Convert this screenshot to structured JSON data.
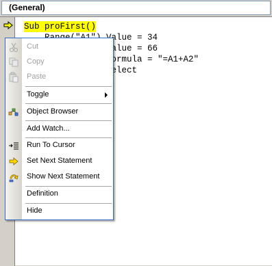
{
  "object_dropdown": {
    "value": "(General)"
  },
  "code": {
    "lines": [
      "Sub proFirst()",
      "    Range(\"A1\").Value = 34",
      "    Range(\"A2\").Value = 66",
      "    Range(\"A3\").Formula = \"=A1+A2\"",
      "    Range(\"A1\").Select"
    ]
  },
  "context_menu": {
    "items": [
      {
        "label": "Cut",
        "icon": "cut-icon",
        "enabled": false
      },
      {
        "label": "Copy",
        "icon": "copy-icon",
        "enabled": false
      },
      {
        "label": "Paste",
        "icon": "paste-icon",
        "enabled": false
      },
      {
        "label": "Toggle",
        "icon": "",
        "enabled": true,
        "submenu": true
      },
      {
        "label": "Object Browser",
        "icon": "object-browser-icon",
        "enabled": true
      },
      {
        "label": "Add Watch...",
        "icon": "",
        "enabled": true
      },
      {
        "label": "Run To Cursor",
        "icon": "run-to-cursor-icon",
        "enabled": true
      },
      {
        "label": "Set Next Statement",
        "icon": "set-next-statement-icon",
        "enabled": true
      },
      {
        "label": "Show Next Statement",
        "icon": "show-next-statement-icon",
        "enabled": true
      },
      {
        "label": "Definition",
        "icon": "",
        "enabled": true
      },
      {
        "label": "Hide",
        "icon": "",
        "enabled": true
      }
    ]
  },
  "colors": {
    "current_line_highlight": "#ffff00",
    "menu_border": "#316ac5",
    "disabled_text": "#a0a0a0"
  }
}
